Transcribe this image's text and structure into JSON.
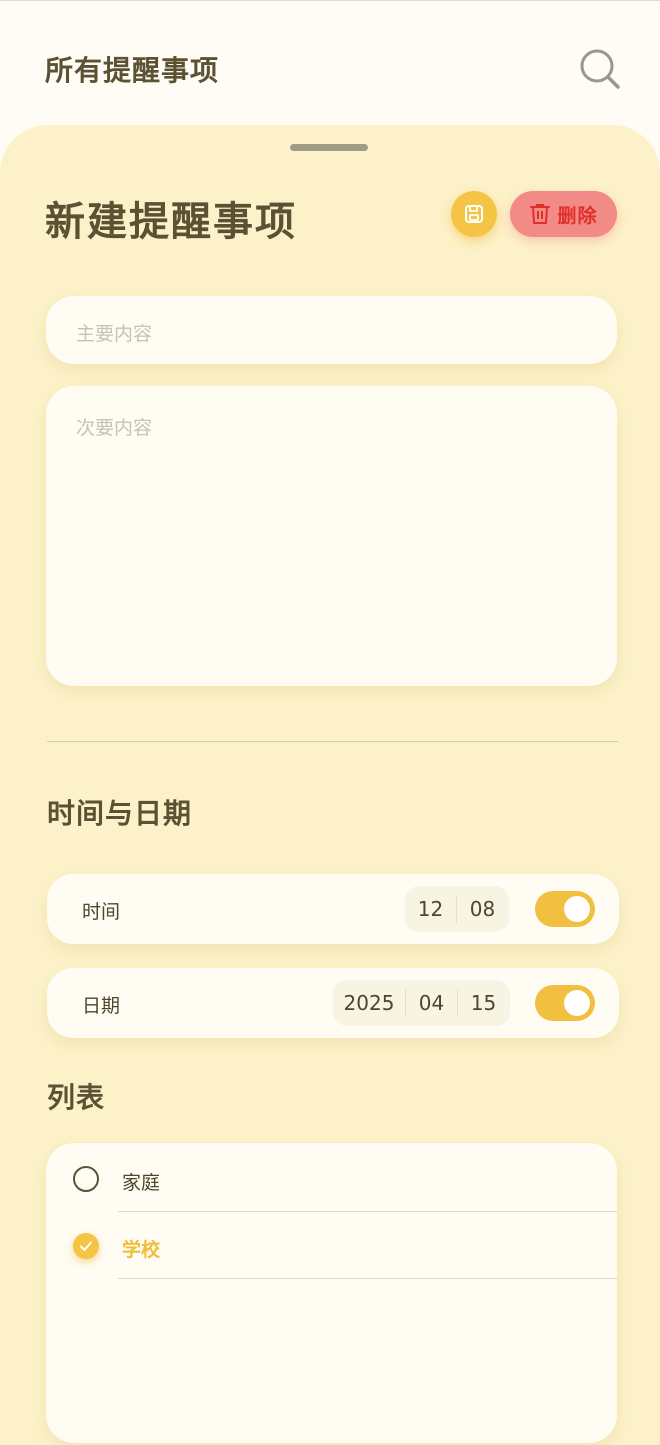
{
  "header": {
    "title": "所有提醒事项",
    "search_icon": "search-icon"
  },
  "sheet": {
    "title": "新建提醒事项",
    "save_icon": "save-icon",
    "delete_label": "删除",
    "delete_icon": "trash-icon"
  },
  "form": {
    "main_placeholder": "主要内容",
    "main_value": "",
    "sub_placeholder": "次要内容",
    "sub_value": ""
  },
  "datetime": {
    "section_title": "时间与日期",
    "time": {
      "label": "时间",
      "hour": "12",
      "minute": "08",
      "enabled": true
    },
    "date": {
      "label": "日期",
      "year": "2025",
      "month": "04",
      "day": "15",
      "enabled": true
    }
  },
  "lists": {
    "section_title": "列表",
    "items": [
      {
        "label": "家庭",
        "checked": false
      },
      {
        "label": "学校",
        "checked": true
      }
    ]
  },
  "colors": {
    "accent": "#f6c444",
    "sheet_bg": "#fcf1c8",
    "delete_bg": "#f28a86",
    "delete_text": "#e0302a",
    "title_text": "#5b5234"
  }
}
